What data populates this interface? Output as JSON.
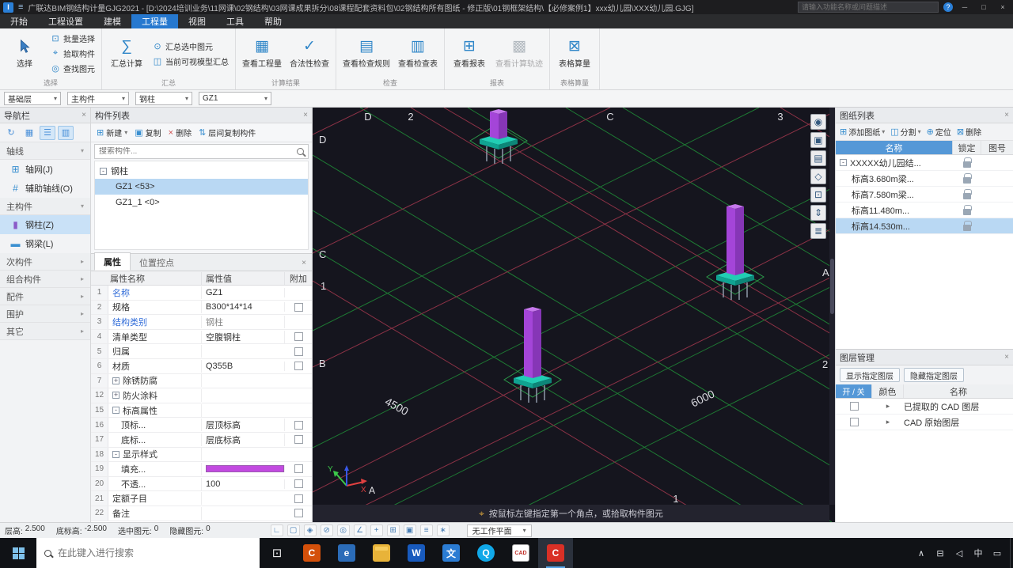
{
  "colors": {
    "accent_blue": "#2678cf",
    "column_purple": "#a445d8",
    "base_plate_teal": "#21cdb4",
    "fill_swatch": "#c24ae0",
    "viewport_bg": "#15151e"
  },
  "titlebar": {
    "app_logo": "I",
    "title": "广联达BIM钢结构计量GJG2021 - [D:\\2024培训业务\\11网课\\02钢结构\\03网课成果拆分\\08课程配套资料包\\02钢结构所有图纸 - 修正版\\01钢框架结构\\【必修案例1】xxx幼儿园\\XXX幼儿园.GJG]",
    "search_placeholder": "请输入功能名称或问题描述"
  },
  "tabs": [
    {
      "label": "开始"
    },
    {
      "label": "工程设置"
    },
    {
      "label": "建模"
    },
    {
      "label": "工程量"
    },
    {
      "label": "视图"
    },
    {
      "label": "工具"
    },
    {
      "label": "帮助"
    }
  ],
  "ribbon": {
    "groups": [
      {
        "label": "选择"
      },
      {
        "label": "汇总"
      },
      {
        "label": "计算结果"
      },
      {
        "label": "检查"
      },
      {
        "label": "报表"
      },
      {
        "label": "表格算量"
      }
    ],
    "buttons": {
      "select": "选择",
      "batch_select": "批量选择",
      "pick_component": "拾取构件",
      "find_element": "查找图元",
      "sum_calc": "汇总计算",
      "sum_selected": "汇总选中图元",
      "sum_visible": "当前可视模型汇总",
      "view_quantity": "查看工程量",
      "legality_check": "合法性检查",
      "view_check_rules": "查看检查规则",
      "view_check_table": "查看检查表",
      "view_report": "查看报表",
      "view_calc_trace": "查看计算轨迹",
      "table_calc": "表格算量"
    }
  },
  "combos": [
    {
      "value": "基础层"
    },
    {
      "value": "主构件"
    },
    {
      "value": "钢柱"
    },
    {
      "value": "GZ1"
    }
  ],
  "nav": {
    "header": "导航栏",
    "sections": {
      "axis": "轴线",
      "main": "主构件",
      "secondary": "次构件",
      "combined": "组合构件",
      "accessory": "配件",
      "enclosure": "围护",
      "other": "其它"
    },
    "items": {
      "grid": "轴网(J)",
      "aux_axis": "辅助轴线(O)",
      "steel_column": "钢柱(Z)",
      "steel_beam": "钢梁(L)"
    }
  },
  "component_list": {
    "header": "构件列表",
    "toolbar": {
      "new": "新建",
      "copy": "复制",
      "delete": "删除",
      "copy_between": "层间复制构件"
    },
    "search_placeholder": "搜索构件...",
    "tree": {
      "parent": "钢柱",
      "child1": "GZ1 <53>",
      "child2": "GZ1_1 <0>"
    }
  },
  "properties": {
    "tab_active": "属性",
    "tab_other": "位置控点",
    "col_name": "属性名称",
    "col_value": "属性值",
    "col_attach": "附加",
    "fill_style": "background:#c24ae0",
    "rows": [
      {
        "no": "1",
        "name": "名称",
        "value": "GZ1"
      },
      {
        "no": "2",
        "name": "规格",
        "value": "B300*14*14"
      },
      {
        "no": "3",
        "name": "结构类别",
        "value": "钢柱"
      },
      {
        "no": "4",
        "name": "清单类型",
        "value": "空腹钢柱"
      },
      {
        "no": "5",
        "name": "归属",
        "value": ""
      },
      {
        "no": "6",
        "name": "材质",
        "value": "Q355B"
      },
      {
        "no": "7",
        "name": "除锈防腐",
        "exp": "+"
      },
      {
        "no": "12",
        "name": "防火涂料",
        "exp": "+"
      },
      {
        "no": "15",
        "name": "标高属性",
        "exp": "-"
      },
      {
        "no": "16",
        "name": "顶标...",
        "value": "层顶标高"
      },
      {
        "no": "17",
        "name": "底标...",
        "value": "层底标高"
      },
      {
        "no": "18",
        "name": "显示样式",
        "exp": "-"
      },
      {
        "no": "19",
        "name": "填充...",
        "value": ""
      },
      {
        "no": "20",
        "name": "不透...",
        "value": "100"
      },
      {
        "no": "21",
        "name": "定额子目",
        "value": ""
      },
      {
        "no": "22",
        "name": "备注",
        "value": ""
      }
    ]
  },
  "viewport": {
    "labels_top": [
      "D",
      "2",
      "C",
      "3"
    ],
    "labels_left": [
      "D",
      "C",
      "1",
      "B"
    ],
    "labels_right": [
      "A",
      "2"
    ],
    "label_bottom": "1",
    "dim1": "4500",
    "dim2": "6000",
    "axis_x": "X",
    "axis_y": "Y",
    "axis_a": "A",
    "hint": "按鼠标左键指定第一个角点，或拾取构件图元"
  },
  "sheet_list": {
    "header": "图纸列表",
    "toolbar": {
      "add": "添加图纸",
      "split": "分割",
      "locate": "定位",
      "delete": "删除"
    },
    "columns": {
      "name": "名称",
      "lock": "锁定",
      "no": "图号"
    },
    "rows": [
      {
        "name": "XXXXX幼儿园结...",
        "exp": "-"
      },
      {
        "name": "标高3.680m梁..."
      },
      {
        "name": "标高7.580m梁..."
      },
      {
        "name": "标高11.480m..."
      },
      {
        "name": "标高14.530m..."
      }
    ]
  },
  "layer_manager": {
    "header": "图层管理",
    "btn_show": "显示指定图层",
    "btn_hide": "隐藏指定图层",
    "columns": {
      "onoff": "开 / 关",
      "color": "颜色",
      "name": "名称"
    },
    "rows": [
      {
        "name": "已提取的 CAD 图层"
      },
      {
        "name": "CAD 原始图层"
      }
    ]
  },
  "statusbar": {
    "floor_height_label": "层高:",
    "floor_height": "2.500",
    "bottom_elev_label": "底标高:",
    "bottom_elev": "-2.500",
    "selected_label": "选中图元:",
    "selected": "0",
    "hidden_label": "隐藏图元:",
    "hidden": "0",
    "workplane": "无工作平面"
  },
  "taskbar": {
    "search_placeholder": "在此键入进行搜索",
    "ime": "中",
    "apps": [
      {
        "label": "C"
      },
      {
        "label": "e"
      },
      {
        "label": ""
      },
      {
        "label": "W"
      },
      {
        "label": "文"
      },
      {
        "label": "Q"
      },
      {
        "label": "CAD"
      },
      {
        "label": "C"
      }
    ]
  },
  "glyphs": {
    "menu": "≡",
    "help": "?",
    "minimize": "─",
    "maximize": "□",
    "close": "×",
    "caret": "▾",
    "caret_right": "▸",
    "tree_exp": "-",
    "batch_select": "⊡",
    "pick": "⌖",
    "find": "◎",
    "sum": "∑",
    "sum_sel": "⊙",
    "sum_vis": "◫",
    "qty": "▦",
    "legal": "✓",
    "rules": "▤",
    "check_table": "▥",
    "report": "⊞",
    "trace": "▩",
    "table_calc": "⊠",
    "nav1": "↻",
    "nav2": "▦",
    "nav3": "☰",
    "nav4": "▥",
    "grid_icon": "⊞",
    "aux_icon": "#",
    "column_icon": "▮",
    "beam_icon": "▬",
    "new": "⊞",
    "copy": "▣",
    "del": "×",
    "copy_between": "⇅",
    "sheet_add": "⊞",
    "sheet_split": "◫",
    "sheet_locate": "⊕",
    "sheet_del": "⊠",
    "vt1": "◉",
    "vt2": "▣",
    "vt3": "▤",
    "vt4": "◇",
    "vt5": "⊡",
    "vt6": "⇕",
    "vt7": "≣",
    "sb1": "∟",
    "sb2": "▢",
    "sb3": "◈",
    "sb4": "⊘",
    "sb5": "◎",
    "sb6": "∠",
    "sb7": "+",
    "sb8": "⊞",
    "sb9": "▣",
    "sb10": "≡",
    "sb11": "∗",
    "tray_chevron": "∧",
    "tray_network": "⊟",
    "tray_volume": "◁",
    "tray_note": "▭",
    "hint_icon": "⌖"
  }
}
